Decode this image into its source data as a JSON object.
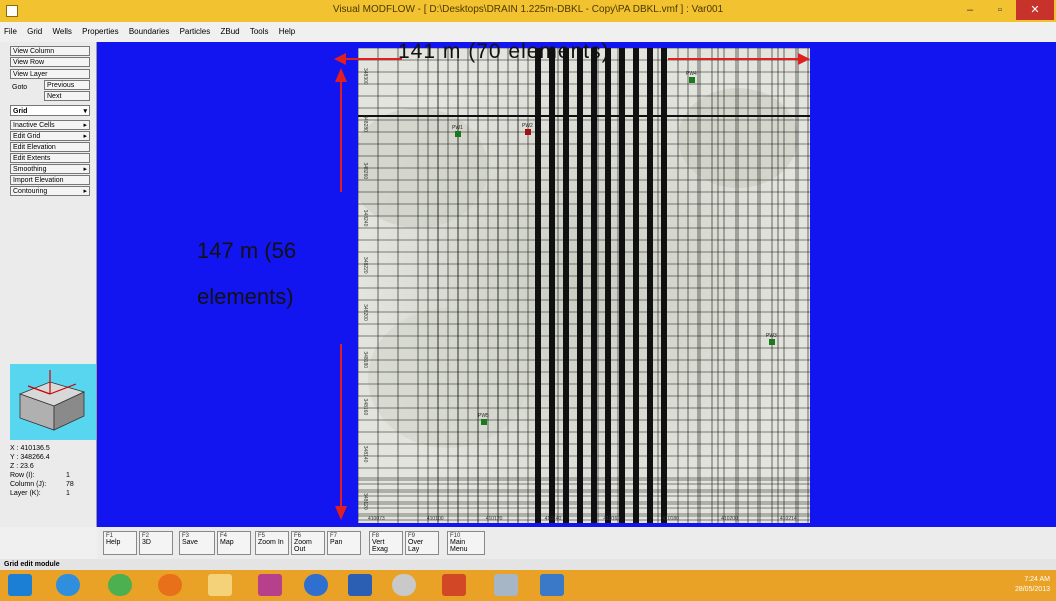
{
  "window": {
    "title": "Visual MODFLOW - [ D:\\Desktops\\DRAIN 1.225m-DBKL - Copy\\PA DBKL.vmf ] : Var001",
    "minimize": "–",
    "maximize": "▫",
    "close": "✕"
  },
  "menu": [
    "File",
    "Grid",
    "Wells",
    "Properties",
    "Boundaries",
    "Particles",
    "ZBud",
    "Tools",
    "Help"
  ],
  "left_panel": {
    "view_column": "View Column",
    "view_row": "View Row",
    "view_layer": "View Layer",
    "goto": "Goto",
    "previous": "Previous",
    "next": "Next",
    "grid_select": "Grid",
    "tools": [
      "Inactive Cells",
      "Edit Grid",
      "Edit Elevation",
      "Edit Extents",
      "Smoothing",
      "Import Elevation",
      "Contouring"
    ]
  },
  "coordinates": {
    "x_label": "X :",
    "x": "410136.5",
    "y_label": "Y :",
    "y": "348266.4",
    "z_label": "Z :",
    "z": "23.6",
    "row_label": "Row (I):",
    "row": "1",
    "column_label": "Column (J):",
    "column": "78",
    "layer_label": "Layer (K):",
    "layer": "1"
  },
  "annotations": {
    "horizontal": "141 m (70 elements)",
    "vertical_line1": "147 m (56",
    "vertical_line2": "elements)"
  },
  "map": {
    "x_ticks": [
      "410073",
      "410100",
      "410120",
      "410140",
      "410160",
      "410180",
      "410200",
      "410214"
    ],
    "y_ticks": [
      "348300",
      "348280",
      "348260",
      "348240",
      "348220",
      "348200",
      "348180",
      "348160",
      "348140",
      "348120"
    ],
    "wells": [
      "PW4",
      "PW1",
      "PW2",
      "PW3",
      "PW5"
    ]
  },
  "function_keys": [
    {
      "key": "F1",
      "label": "Help"
    },
    {
      "key": "F2",
      "label": "3D"
    },
    {
      "key": "F3",
      "label": "Save"
    },
    {
      "key": "F4",
      "label": "Map"
    },
    {
      "key": "F5",
      "label": "Zoom In"
    },
    {
      "key": "F6",
      "label": "Zoom Out"
    },
    {
      "key": "F7",
      "label": "Pan"
    },
    {
      "key": "F8",
      "label": "Vert Exag"
    },
    {
      "key": "F9",
      "label": "Over Lay"
    },
    {
      "key": "F10",
      "label": "Main Menu"
    }
  ],
  "status": "Grid edit module",
  "clock": {
    "time": "7:24 AM",
    "date": "28/05/2013"
  },
  "colors": {
    "titlebar": "#f2c230",
    "workspace": "#1315f0",
    "taskbar": "#e9a226",
    "annotation_arrow": "#e02020"
  }
}
